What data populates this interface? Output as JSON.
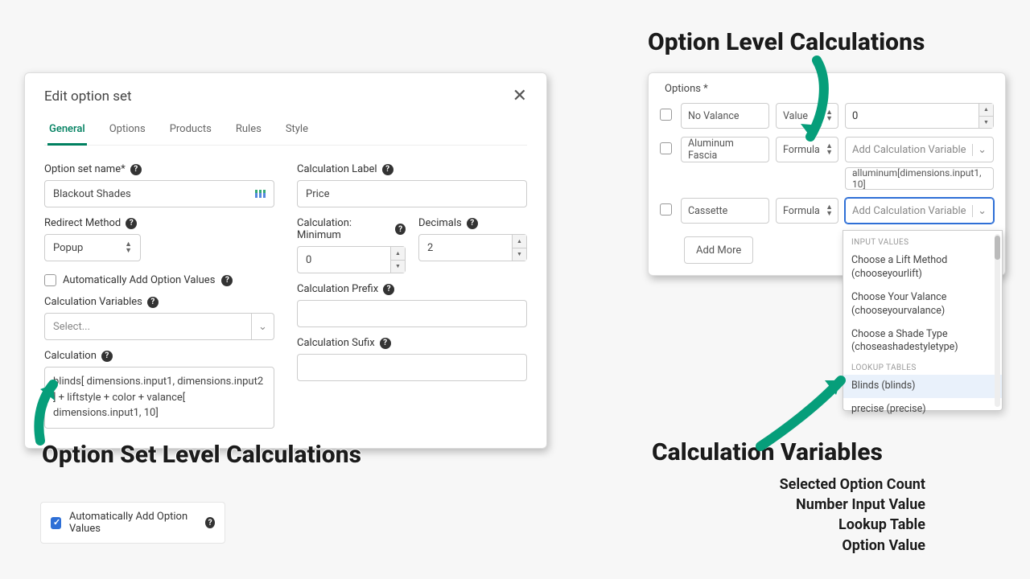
{
  "annotations": {
    "top_right": "Option Level Calculations",
    "bottom_left": "Option Set Level Calculations",
    "bottom_right": "Calculation Variables",
    "sub_lines": [
      "Selected Option Count",
      "Number Input Value",
      "Lookup Table",
      "Option Value"
    ]
  },
  "dialog": {
    "title": "Edit option set",
    "tabs": [
      "General",
      "Options",
      "Products",
      "Rules",
      "Style"
    ],
    "active_tab": 0,
    "left": {
      "name_label": "Option set name*",
      "name_value": "Blackout Shades",
      "redirect_label": "Redirect Method",
      "redirect_value": "Popup",
      "auto_add_label": "Automatically Add Option Values",
      "auto_add_checked": false,
      "vars_label": "Calculation Variables",
      "vars_placeholder": "Select...",
      "calc_label": "Calculation",
      "calc_text": "blinds[ dimensions.input1, dimensions.input2 ]   +  liftstyle + color +  valance[  dimensions.input1, 10]"
    },
    "right": {
      "calc_label_label": "Calculation Label",
      "calc_label_value": "Price",
      "min_label": "Calculation: Minimum",
      "min_value": "0",
      "dec_label": "Decimals",
      "dec_value": "2",
      "prefix_label": "Calculation Prefix",
      "prefix_value": "",
      "suffix_label": "Calculation Sufix",
      "suffix_value": ""
    }
  },
  "bottom_check": {
    "label": "Automatically Add Option Values",
    "checked": true
  },
  "options_panel": {
    "title": "Options *",
    "rows": [
      {
        "name": "No Valance",
        "type": "Value",
        "value": "0"
      },
      {
        "name": "Aluminum Fascia",
        "type": "Formula",
        "placeholder": "Add Calculation Variable",
        "formula": "alluminum[dimensions.input1, 10]"
      },
      {
        "name": "Cassette",
        "type": "Formula",
        "placeholder": "Add Calculation Variable",
        "focused": true
      }
    ],
    "add_more": "Add More"
  },
  "dropdown": {
    "groups": [
      {
        "header": "INPUT VALUES",
        "items": [
          "Choose a Lift Method (chooseyourlift)",
          "Choose Your Valance (chooseyourvalance)",
          "Choose a Shade Type (choseashadestyletype)"
        ]
      },
      {
        "header": "LOOKUP TABLES",
        "items": [
          "Blinds (blinds)",
          "precise (precise)"
        ],
        "selected_index": 0
      }
    ]
  }
}
